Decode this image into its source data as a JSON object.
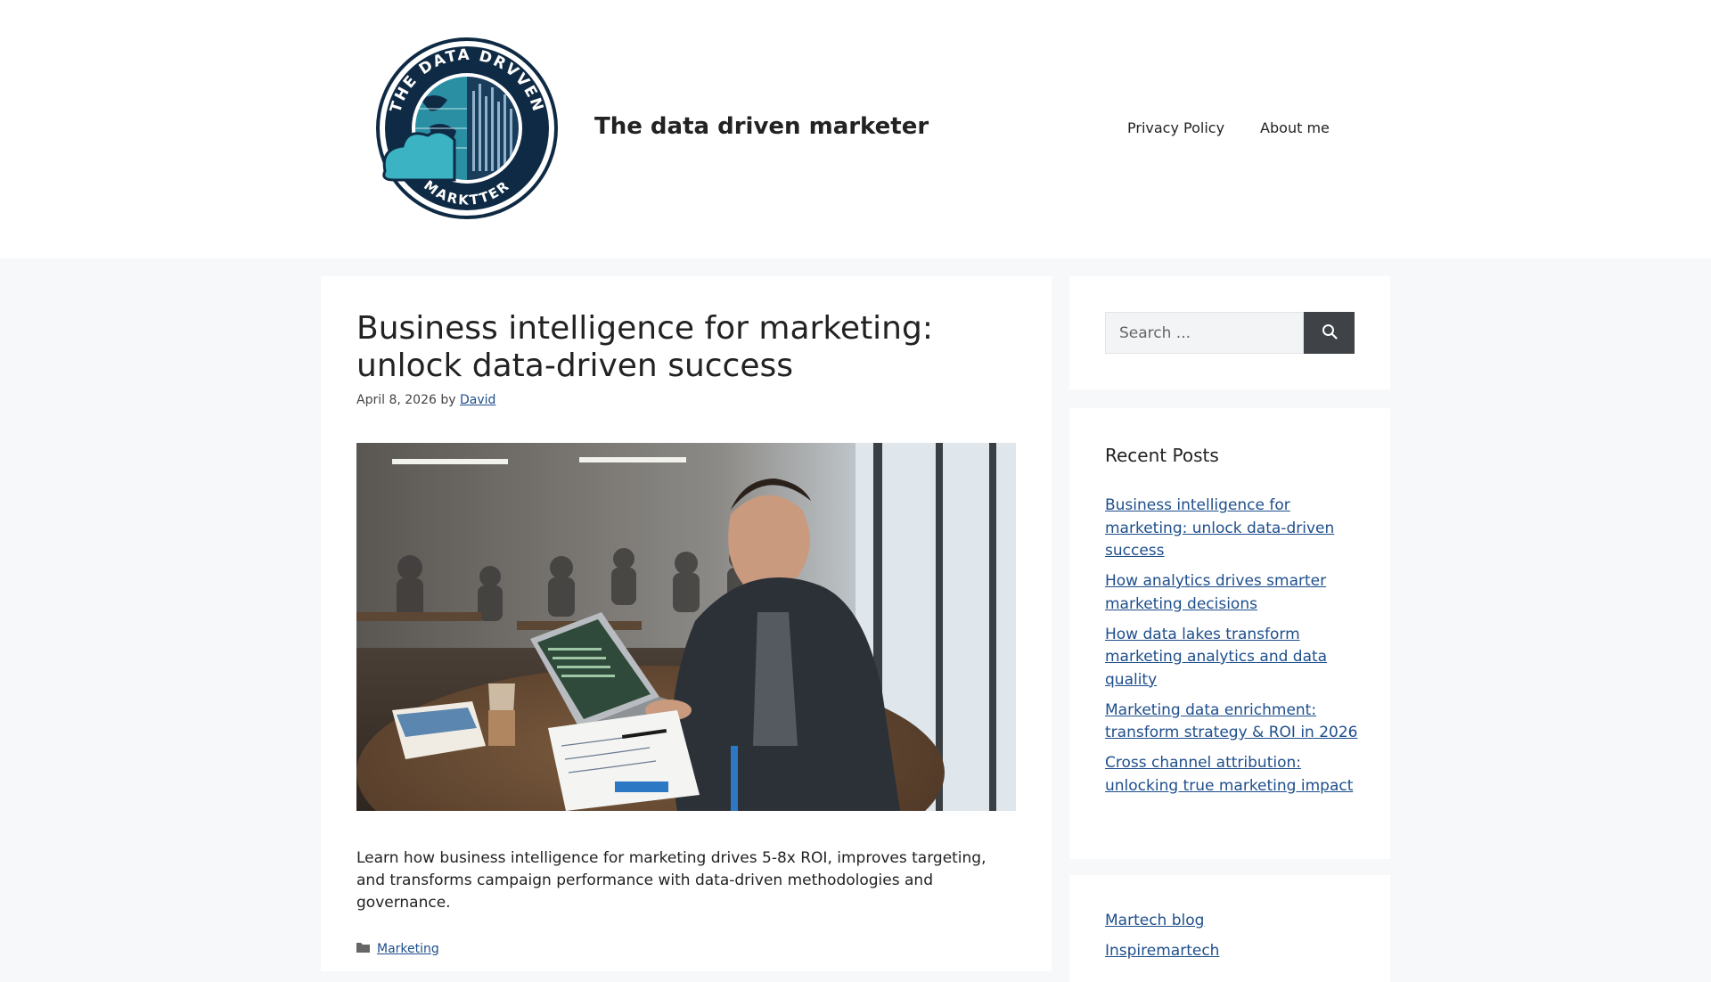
{
  "site": {
    "title": "The data driven marketer",
    "logo_alt": "The Data Drvven Marktter logo",
    "logo_text_top": "THE DATA DRVVEN",
    "logo_text_bottom": "MARKTTER"
  },
  "nav": {
    "items": [
      {
        "label": "Privacy Policy"
      },
      {
        "label": "About me"
      }
    ]
  },
  "article": {
    "title": "Business intelligence for marketing: unlock data-driven success",
    "date": "April 8, 2026",
    "by": "by",
    "author": "David",
    "image_alt": "Man working on a laptop in a busy office cafe",
    "excerpt": "Learn how business intelligence for marketing drives 5-8x ROI, improves targeting, and transforms campaign performance with data-driven methodologies and governance.",
    "category": "Marketing"
  },
  "sidebar": {
    "search": {
      "placeholder": "Search ...",
      "button_icon": "search-icon"
    },
    "recent_posts": {
      "heading": "Recent Posts",
      "items": [
        {
          "label": "Business intelligence for marketing: unlock data-driven success"
        },
        {
          "label": "How analytics drives smarter marketing decisions"
        },
        {
          "label": "How data lakes transform marketing analytics and data quality"
        },
        {
          "label": "Marketing data enrichment: transform strategy & ROI in 2026"
        },
        {
          "label": "Cross channel attribution: unlocking true marketing impact"
        }
      ]
    },
    "links": {
      "items": [
        {
          "label": "Martech blog"
        },
        {
          "label": "Inspiremartech"
        }
      ]
    }
  },
  "colors": {
    "link": "#1e4e8c",
    "page_bg": "#f7f8f9",
    "button_dark": "#3f4347",
    "logo_navy": "#0f2a44",
    "logo_teal": "#3bb3c3"
  }
}
